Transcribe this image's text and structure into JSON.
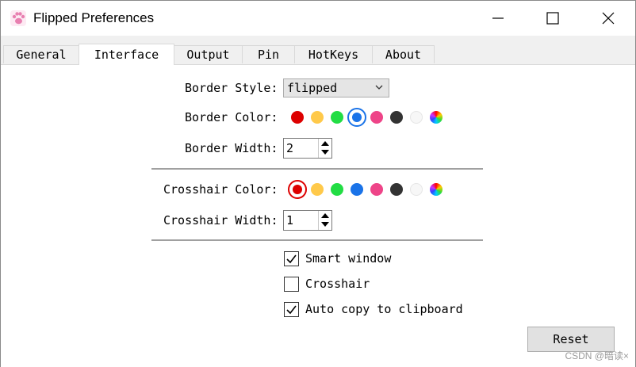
{
  "window": {
    "title": "Flipped Preferences"
  },
  "tabs": [
    {
      "label": "General"
    },
    {
      "label": "Interface"
    },
    {
      "label": "Output"
    },
    {
      "label": "Pin"
    },
    {
      "label": "HotKeys"
    },
    {
      "label": "About"
    }
  ],
  "active_tab": "Interface",
  "border": {
    "style_label": "Border Style:",
    "style_value": "flipped",
    "color_label": "Border Color:",
    "width_label": "Border Width:",
    "width_value": "2",
    "selected_color": "#1a73e8"
  },
  "crosshair": {
    "color_label": "Crosshair Color:",
    "width_label": "Crosshair Width:",
    "width_value": "1",
    "selected_color": "#dd0000"
  },
  "palette": [
    "#dd0000",
    "#ffc94a",
    "#22dd44",
    "#1a73e8",
    "#ee4488",
    "#333333",
    "#f7f7f7",
    "rainbow"
  ],
  "options": [
    {
      "label": "Smart window",
      "checked": true
    },
    {
      "label": "Crosshair",
      "checked": false
    },
    {
      "label": "Auto copy to clipboard",
      "checked": true
    }
  ],
  "reset_label": "Reset",
  "watermark": "CSDN @暗读×"
}
